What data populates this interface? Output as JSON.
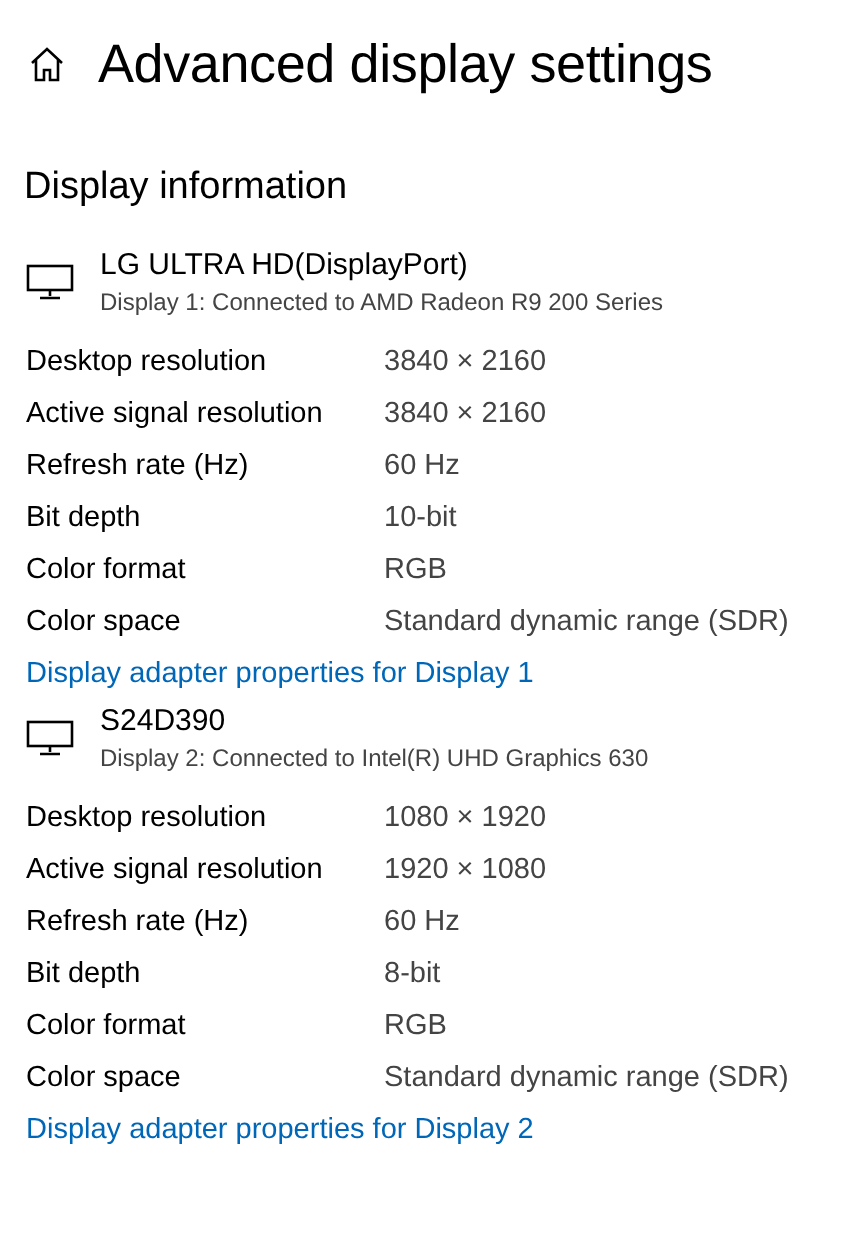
{
  "title": "Advanced display settings",
  "section": "Display information",
  "displays": [
    {
      "name": "LG ULTRA HD(DisplayPort)",
      "subtitle": "Display 1: Connected to AMD Radeon R9 200 Series",
      "properties": [
        {
          "label": "Desktop resolution",
          "value": "3840 × 2160"
        },
        {
          "label": "Active signal resolution",
          "value": "3840 × 2160"
        },
        {
          "label": "Refresh rate (Hz)",
          "value": "60 Hz"
        },
        {
          "label": "Bit depth",
          "value": "10-bit"
        },
        {
          "label": "Color format",
          "value": "RGB"
        },
        {
          "label": "Color space",
          "value": "Standard dynamic range (SDR)"
        }
      ],
      "link": "Display adapter properties for Display 1"
    },
    {
      "name": "S24D390",
      "subtitle": "Display 2: Connected to Intel(R) UHD Graphics 630",
      "properties": [
        {
          "label": "Desktop resolution",
          "value": "1080 × 1920"
        },
        {
          "label": "Active signal resolution",
          "value": "1920 × 1080"
        },
        {
          "label": "Refresh rate (Hz)",
          "value": "60 Hz"
        },
        {
          "label": "Bit depth",
          "value": "8-bit"
        },
        {
          "label": "Color format",
          "value": "RGB"
        },
        {
          "label": "Color space",
          "value": "Standard dynamic range (SDR)"
        }
      ],
      "link": "Display adapter properties for Display 2"
    }
  ]
}
